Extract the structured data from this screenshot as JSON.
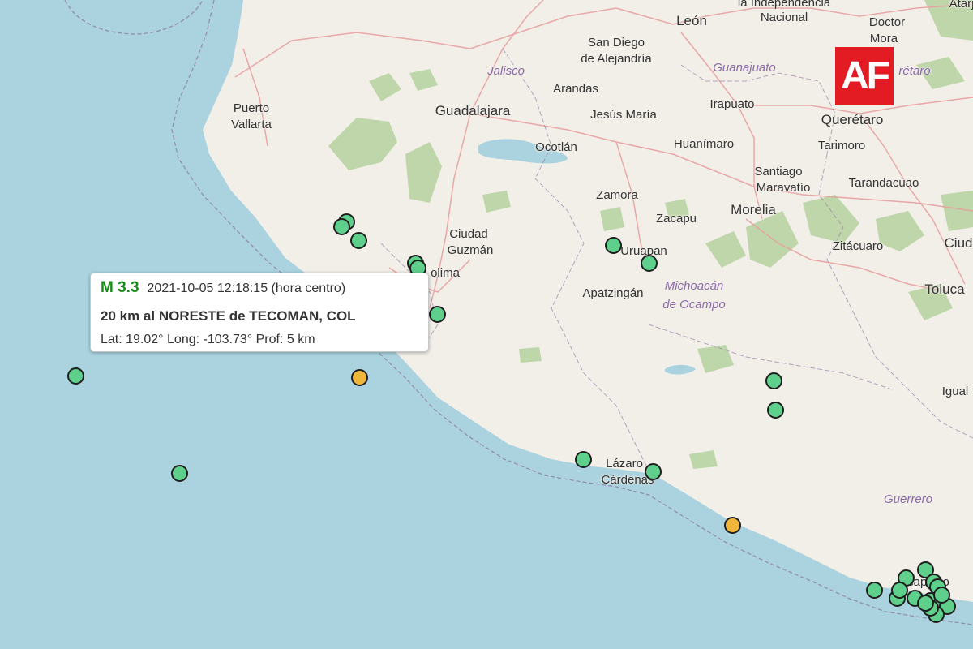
{
  "labels": [
    {
      "text": "la Independencia",
      "kind": "town"
    },
    {
      "text": "Nacional",
      "kind": "town"
    },
    {
      "text": "León",
      "kind": "city"
    },
    {
      "text": "Doctor",
      "kind": "town"
    },
    {
      "text": "Mora",
      "kind": "town"
    },
    {
      "text": "Atarj",
      "kind": "town"
    },
    {
      "text": "San Diego",
      "kind": "town"
    },
    {
      "text": "de Alejandría",
      "kind": "town"
    },
    {
      "text": "Jalisco",
      "kind": "region"
    },
    {
      "text": "Guanajuato",
      "kind": "region"
    },
    {
      "text": "rétaro",
      "kind": "region"
    },
    {
      "text": "Arandas",
      "kind": "town"
    },
    {
      "text": "Puerto",
      "kind": "town"
    },
    {
      "text": "Vallarta",
      "kind": "town"
    },
    {
      "text": "Guadalajara",
      "kind": "city"
    },
    {
      "text": "Jesús María",
      "kind": "town"
    },
    {
      "text": "Irapuato",
      "kind": "town"
    },
    {
      "text": "Querétaro",
      "kind": "city"
    },
    {
      "text": "Ocotlán",
      "kind": "town"
    },
    {
      "text": "Huanímaro",
      "kind": "town"
    },
    {
      "text": "Tarimoro",
      "kind": "town"
    },
    {
      "text": "Santiago",
      "kind": "town"
    },
    {
      "text": "Maravatío",
      "kind": "town"
    },
    {
      "text": "Tarandacuao",
      "kind": "town"
    },
    {
      "text": "Zamora",
      "kind": "town"
    },
    {
      "text": "Morelia",
      "kind": "city"
    },
    {
      "text": "Zacapu",
      "kind": "town"
    },
    {
      "text": "Ciudad",
      "kind": "town"
    },
    {
      "text": "Guzmán",
      "kind": "town"
    },
    {
      "text": "Ciud",
      "kind": "city"
    },
    {
      "text": "Zitácuaro",
      "kind": "town"
    },
    {
      "text": "Uruapan",
      "kind": "town"
    },
    {
      "text": "olima",
      "kind": "town"
    },
    {
      "text": "Michoacán",
      "kind": "region"
    },
    {
      "text": "de Ocampo",
      "kind": "region"
    },
    {
      "text": "Apatzingán",
      "kind": "town"
    },
    {
      "text": "Toluca",
      "kind": "city"
    },
    {
      "text": "Igual",
      "kind": "town"
    },
    {
      "text": "Lázaro",
      "kind": "town"
    },
    {
      "text": "Cárdenas",
      "kind": "town"
    },
    {
      "text": "Guerrero",
      "kind": "region"
    },
    {
      "text": "Acapulco",
      "kind": "town"
    }
  ],
  "earthquakes": [
    {
      "lat": 19.02,
      "lon": -103.73,
      "color": "#f0b63c",
      "selected": true
    },
    {
      "color": "#5fcf8c"
    }
  ],
  "popup": {
    "magnitude": "M 3.3",
    "datetime": "2021-10-05   12:18:15 (hora centro)",
    "location": "20 km al NORESTE de TECOMAN, COL",
    "coords": "Lat: 19.02°   Long: -103.73°   Prof: 5 km"
  },
  "logo": {
    "text": "AF",
    "color": "#e31b23"
  },
  "colors": {
    "sea": "#aad3df",
    "land": "#f2efe9",
    "forest": "#b5d29f",
    "highway": "#e8a0a0",
    "border": "#9e7fa8",
    "quake_green": "#5fcf8c",
    "quake_orange": "#f0b63c"
  }
}
